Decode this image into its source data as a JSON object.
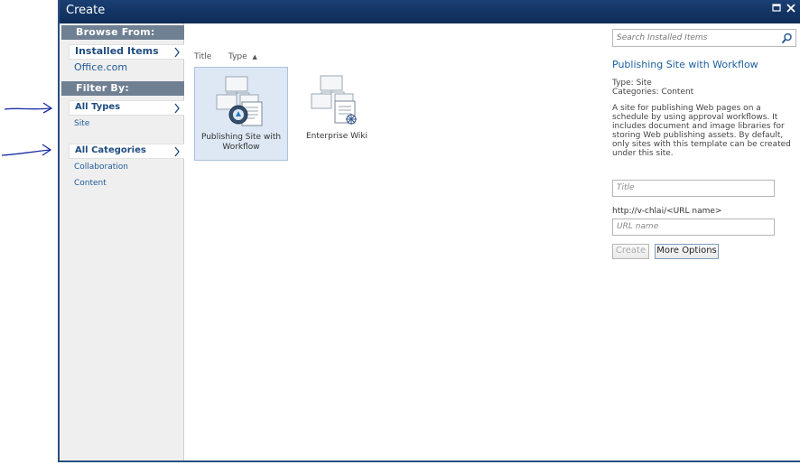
{
  "dialog": {
    "title": "Create"
  },
  "leftnav": {
    "browse_header": "Browse From:",
    "installed_items": "Installed Items",
    "office_com": "Office.com",
    "filter_header": "Filter By:",
    "all_types": "All Types",
    "site": "Site",
    "all_categories": "All Categories",
    "collaboration": "Collaboration",
    "content": "Content"
  },
  "list": {
    "col_title": "Title",
    "col_type": "Type",
    "sort_indicator": "▲",
    "items": [
      {
        "label": "Publishing Site with Workflow",
        "icon": "publishing-site-template-icon",
        "selected": true
      },
      {
        "label": "Enterprise Wiki",
        "icon": "enterprise-wiki-template-icon",
        "selected": false
      }
    ]
  },
  "panel": {
    "search_placeholder": "Search Installed Items",
    "title": "Publishing Site with Workflow",
    "type_line": "Type: Site",
    "categories_line": "Categories: Content",
    "description": "A site for publishing Web pages on a schedule by using approval workflows. It includes document and image libraries for storing Web publishing assets. By default, only sites with this template can be created under this site.",
    "title_placeholder": "Title",
    "url_prefix": "http://v-chlai/<URL name>",
    "url_placeholder": "URL name",
    "create_label": "Create",
    "more_options_label": "More Options"
  },
  "colors": {
    "titlebar": "#0e2c57",
    "nav_header": "#6f8093",
    "link": "#1f5a96",
    "accent_text": "#1a5f9e",
    "annotation": "#1b2fa6"
  }
}
